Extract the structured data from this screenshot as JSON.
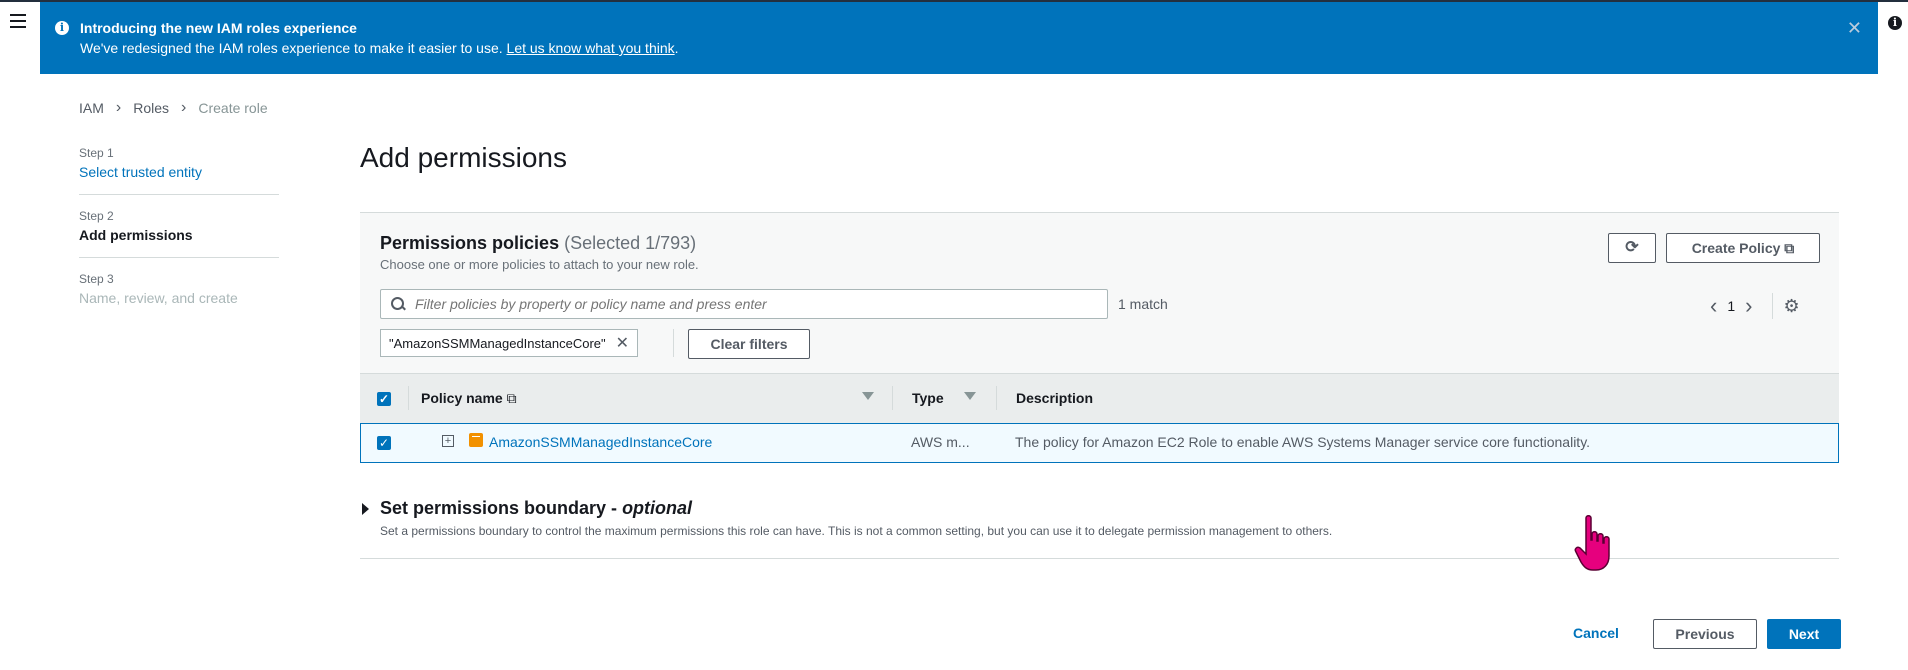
{
  "banner": {
    "title": "Introducing the new IAM roles experience",
    "body": "We've redesigned the IAM roles experience to make it easier to use.",
    "link": "Let us know what you think",
    "period": "."
  },
  "breadcrumb": {
    "iam": "IAM",
    "roles": "Roles",
    "current": "Create role"
  },
  "steps": [
    {
      "num": "Step 1",
      "label": "Select trusted entity"
    },
    {
      "num": "Step 2",
      "label": "Add permissions"
    },
    {
      "num": "Step 3",
      "label": "Name, review, and create"
    }
  ],
  "page_title": "Add permissions",
  "policies": {
    "title": "Permissions policies",
    "count": "(Selected 1/793)",
    "description": "Choose one or more policies to attach to your new role.",
    "create_policy_label": "Create Policy",
    "search_placeholder": "Filter policies by property or policy name and press enter",
    "match_count": "1 match",
    "page_number": "1",
    "filter_token": "\"AmazonSSMManagedInstanceCore\"",
    "clear_filters_label": "Clear filters",
    "columns": {
      "name": "Policy name",
      "type": "Type",
      "description": "Description"
    },
    "rows": [
      {
        "name": "AmazonSSMManagedInstanceCore",
        "type": "AWS m...",
        "description": "The policy for Amazon EC2 Role to enable AWS Systems Manager service core functionality."
      }
    ]
  },
  "boundary": {
    "title": "Set permissions boundary - ",
    "optional": "optional",
    "description": "Set a permissions boundary to control the maximum permissions this role can have. This is not a common setting, but you can use it to delegate permission management to others."
  },
  "footer": {
    "cancel": "Cancel",
    "previous": "Previous",
    "next": "Next"
  },
  "icons": {
    "menu": "hamburger-menu-icon",
    "info": "info-icon",
    "close": "close-icon",
    "refresh": "refresh-icon",
    "external": "external-link-icon",
    "search": "search-icon",
    "settings": "gear-icon",
    "policy": "aws-managed-policy-icon",
    "cursor": "hand-pointer-icon"
  },
  "colors": {
    "banner": "#0073bb",
    "primary": "#0073bb",
    "policy_icon": "#f29100",
    "cursor": "#e6007e"
  }
}
